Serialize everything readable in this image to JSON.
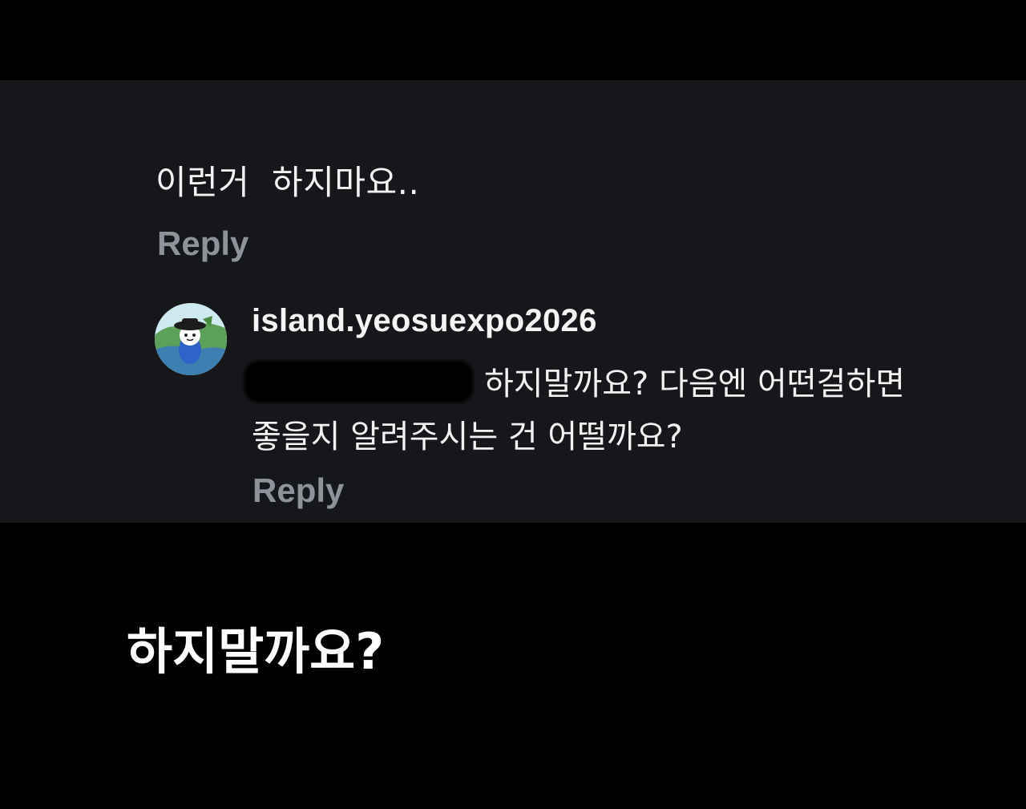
{
  "comment": {
    "text": "이런거  하지마요..",
    "reply_label": "Reply"
  },
  "reply": {
    "username": "island.yeosuexpo2026",
    "avatar_icon": "mascot-avatar-icon",
    "text_line1": "하지말까요? 다음엔 어떤걸하면",
    "text_line2": "좋을지 알려주시는 건 어떨까요?",
    "reply_label": "Reply"
  },
  "caption": {
    "text": "하지말까요?"
  },
  "colors": {
    "background": "#000000",
    "panel": "#15171b",
    "text": "#f2f2f2",
    "reply_link": "#8e929a"
  }
}
